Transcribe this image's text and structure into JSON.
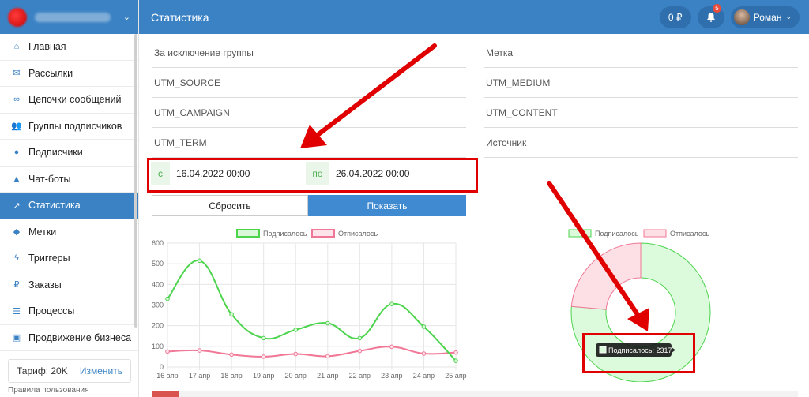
{
  "sidebar": {
    "items": [
      {
        "label": "Главная",
        "icon": "home-icon",
        "glyph": "⌂"
      },
      {
        "label": "Рассылки",
        "icon": "envelope-icon",
        "glyph": "✉"
      },
      {
        "label": "Цепочки сообщений",
        "icon": "link-icon",
        "glyph": "∞"
      },
      {
        "label": "Группы подписчиков",
        "icon": "users-icon",
        "glyph": "👥"
      },
      {
        "label": "Подписчики",
        "icon": "user-icon",
        "glyph": "●"
      },
      {
        "label": "Чат-боты",
        "icon": "android-icon",
        "glyph": "▲"
      },
      {
        "label": "Статистика",
        "icon": "line-chart-icon",
        "glyph": "↗"
      },
      {
        "label": "Метки",
        "icon": "tag-icon",
        "glyph": "◆"
      },
      {
        "label": "Триггеры",
        "icon": "bolt-icon",
        "glyph": "ϟ"
      },
      {
        "label": "Заказы",
        "icon": "ruble-icon",
        "glyph": "₽"
      },
      {
        "label": "Процессы",
        "icon": "list-icon",
        "glyph": "☰"
      },
      {
        "label": "Продвижение бизнеса",
        "icon": "briefcase-icon",
        "glyph": "▣"
      }
    ],
    "active_index": 6,
    "tariff_label": "Тариф: 20K",
    "change_label": "Изменить",
    "rules_label": "Правила пользования"
  },
  "header": {
    "title": "Статистика",
    "balance": "0 ₽",
    "notifications": "5",
    "user_name": "Роман"
  },
  "filters": {
    "exclude_group": "За исключение группы",
    "tag": "Метка",
    "utm_source": "UTM_SOURCE",
    "utm_medium": "UTM_MEDIUM",
    "utm_campaign": "UTM_CAMPAIGN",
    "utm_content": "UTM_CONTENT",
    "utm_term": "UTM_TERM",
    "source": "Источник",
    "from_label": "с",
    "from_value": "16.04.2022 00:00",
    "to_label": "по",
    "to_value": "26.04.2022 00:00",
    "reset_label": "Сбросить",
    "show_label": "Показать"
  },
  "colors": {
    "accent": "#3b82c4",
    "subscribed": "#4cd44c",
    "unsubscribed": "#f07896",
    "highlight": "#e00000"
  },
  "chart_data": [
    {
      "type": "line",
      "categories": [
        "16 апр",
        "17 апр",
        "18 апр",
        "19 апр",
        "20 апр",
        "21 апр",
        "22 апр",
        "23 апр",
        "24 апр",
        "25 апр"
      ],
      "series": [
        {
          "name": "Подписалось",
          "values": [
            330,
            515,
            255,
            140,
            180,
            212,
            140,
            305,
            195,
            30
          ]
        },
        {
          "name": "Отписалось",
          "values": [
            75,
            80,
            60,
            50,
            63,
            52,
            78,
            98,
            65,
            70
          ]
        }
      ],
      "ylim": [
        0,
        600
      ],
      "yticks": [
        0,
        100,
        200,
        300,
        400,
        500,
        600
      ],
      "legend": "top",
      "grid": true
    },
    {
      "type": "pie",
      "variant": "doughnut",
      "categories": [
        "Подписалось",
        "Отписалось"
      ],
      "values": [
        2317,
        716
      ],
      "legend": "top",
      "tooltip": "Подписалось: 2317"
    }
  ]
}
